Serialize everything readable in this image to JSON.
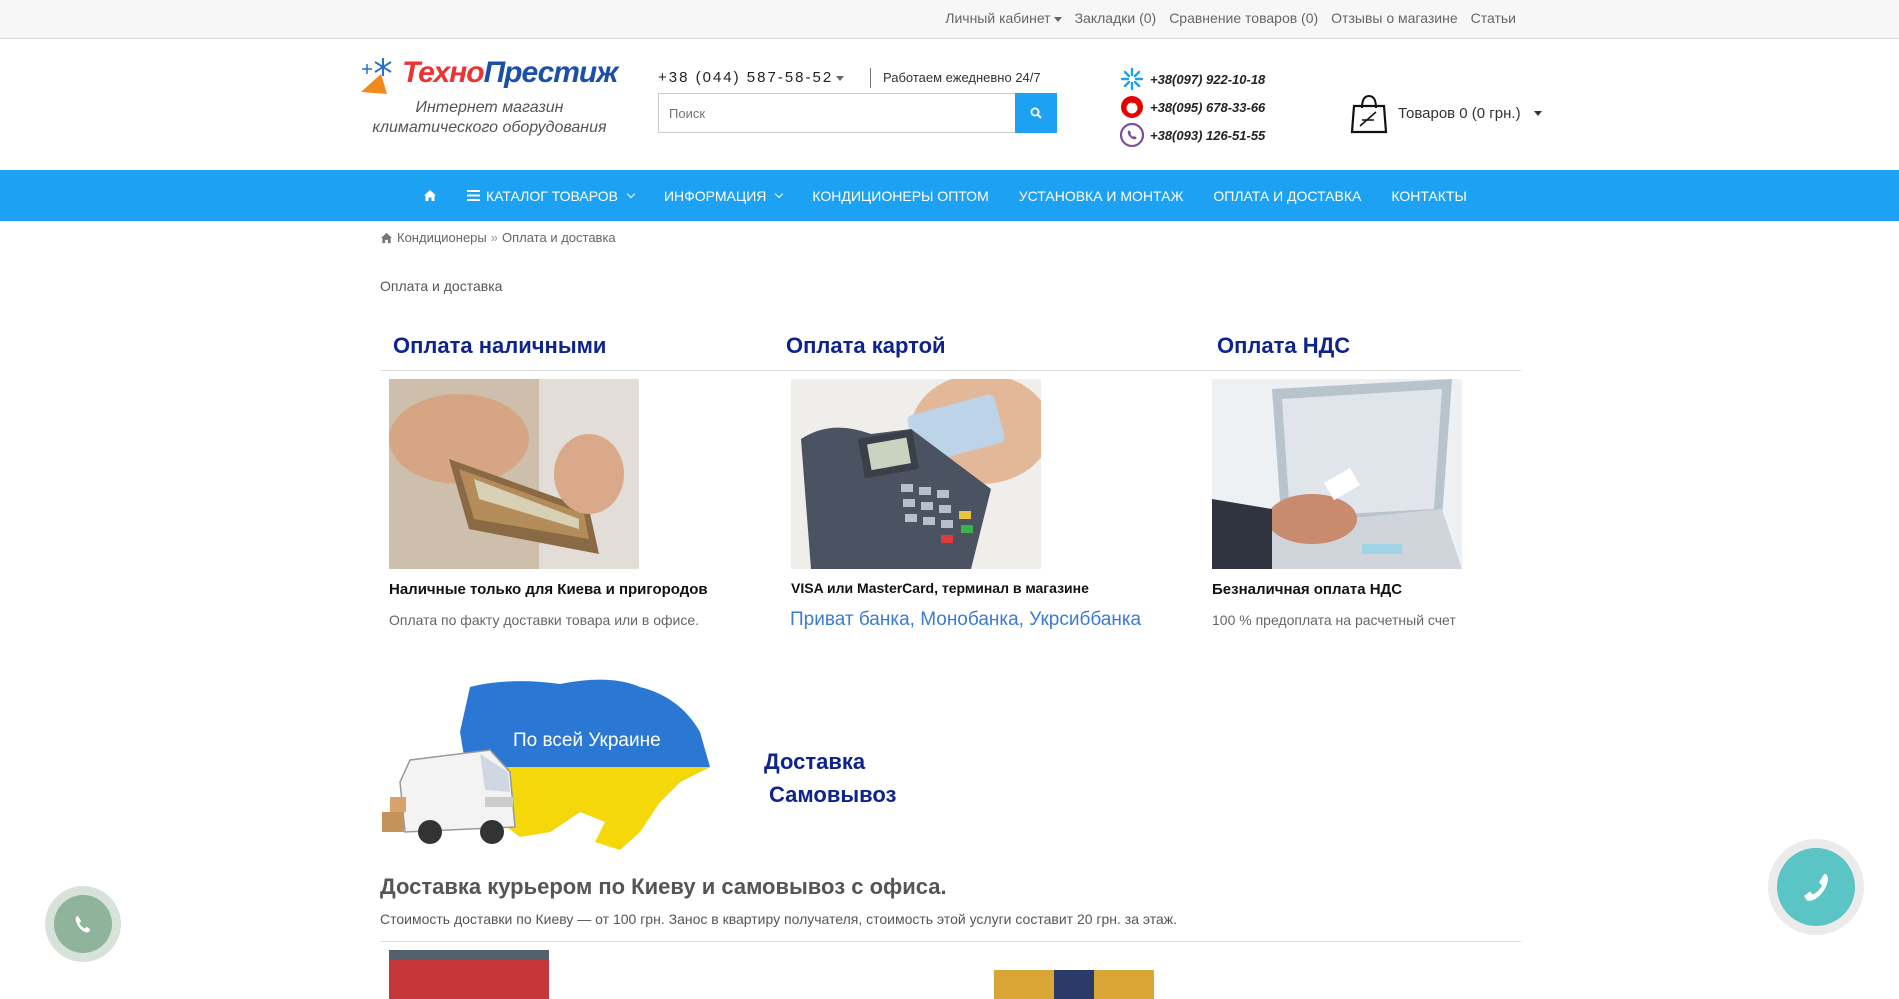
{
  "topbar": {
    "account": "Личный кабинет",
    "bookmarks": "Закладки (0)",
    "compare": "Сравнение товаров (0)",
    "reviews": "Отзывы о магазине",
    "articles": "Статьи"
  },
  "header": {
    "logo_part1": "Техно",
    "logo_part2": "Престиж",
    "tagline_line1": "Интернет магазин",
    "tagline_line2": "климатического оборудования",
    "main_phone": "+38 (044) 587-58-52",
    "work_hours": "Работаем ежедневно 24/7",
    "search_placeholder": "Поиск",
    "phones": [
      {
        "number": "+38(097) 922-10-18",
        "icon": "kyivstar-icon",
        "color": "#1da1f2"
      },
      {
        "number": "+38(095) 678-33-66",
        "icon": "vodafone-icon",
        "color": "#e60000"
      },
      {
        "number": "+38(093) 126-51-55",
        "icon": "viber-icon",
        "color": "#7b519d"
      }
    ],
    "cart_label": "Товаров 0 (0 грн.)"
  },
  "nav": {
    "catalog": "Каталог товаров",
    "info": "Информация",
    "wholesale": "Кондиционеры оптом",
    "install": "Установка и монтаж",
    "payment": "Оплата и доставка",
    "contacts": "Контакты"
  },
  "breadcrumb": {
    "home": "Кондиционеры",
    "current": "Оплата и доставка"
  },
  "page_title": "Оплата и доставка",
  "payment": [
    {
      "title": "Оплата наличными",
      "subtitle": "Наличные только для Киева и пригородов",
      "desc": "Оплата по факту доставки товара или в офисе."
    },
    {
      "title": "Оплата картой",
      "subtitle": "VISA или MasterCard, терминал в магазине",
      "desc": "Приват банка, Монобанка, Укрсиббанка"
    },
    {
      "title": "Оплата НДС",
      "subtitle": "Безналичная оплата НДС",
      "desc": "100 % предоплата на расчетный счет"
    }
  ],
  "delivery": {
    "map_label": "По всей Украине",
    "title1": "Доставка",
    "title2": "Самовывоз",
    "heading": "Доставка курьером по Киеву и самовывоз с офиса.",
    "text": "Стоимость доставки по Киеву — от 100 грн. Занос в квартиру получателя, стоимость этой услуги составит 20 грн. за этаж."
  },
  "colors": {
    "accent": "#1da1f2",
    "heading": "#0f238c"
  }
}
